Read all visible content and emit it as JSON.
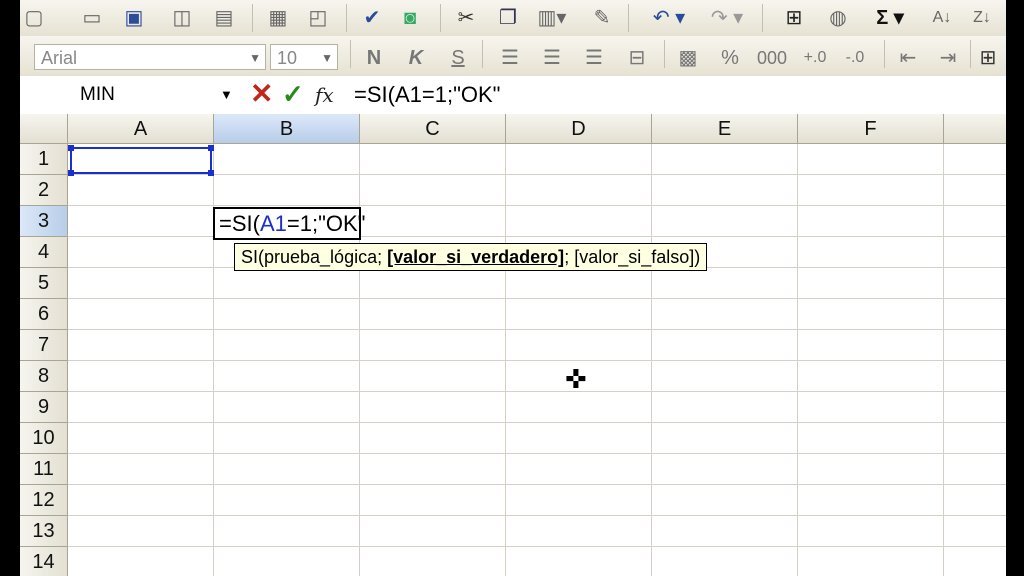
{
  "toolbar_standard": {
    "icons": [
      "new-icon",
      "open-icon",
      "save-icon",
      "permission-icon",
      "print-icon",
      "print-preview-icon",
      "spelling-icon",
      "research-icon",
      "cut-icon",
      "copy-icon",
      "paste-icon",
      "format-painter-icon",
      "undo-icon",
      "redo-icon",
      "hyperlink-icon",
      "autosum-icon",
      "sort-ascending-icon",
      "sort-descending-icon"
    ],
    "autosum_label": "Σ"
  },
  "toolbar_format": {
    "font_name": "Arial",
    "font_size": "10",
    "bold": "N",
    "italic": "K",
    "underline": "S",
    "percent": "%",
    "thousands": "000"
  },
  "formula_bar": {
    "name_box": "MIN",
    "cancel_glyph": "✕",
    "enter_glyph": "✓",
    "fx_label": "fx",
    "formula": "=SI(A1=1;\"OK\""
  },
  "grid": {
    "columns": [
      "A",
      "B",
      "C",
      "D",
      "E",
      "F"
    ],
    "rows": [
      "1",
      "2",
      "3",
      "4",
      "5",
      "6",
      "7",
      "8",
      "9",
      "10",
      "11",
      "12",
      "13",
      "14"
    ],
    "selected_column": "B",
    "selected_row": "3"
  },
  "active_cell": {
    "text_prefix": "=SI(",
    "text_ref": "A1",
    "text_suffix": "=1;\"OK\""
  },
  "tooltip": {
    "func": "SI(prueba_lógica; ",
    "current_arg": "[valor_si_verdadero]",
    "rest": "; [valor_si_falso])"
  },
  "cursor": {
    "glyph": "✜"
  }
}
